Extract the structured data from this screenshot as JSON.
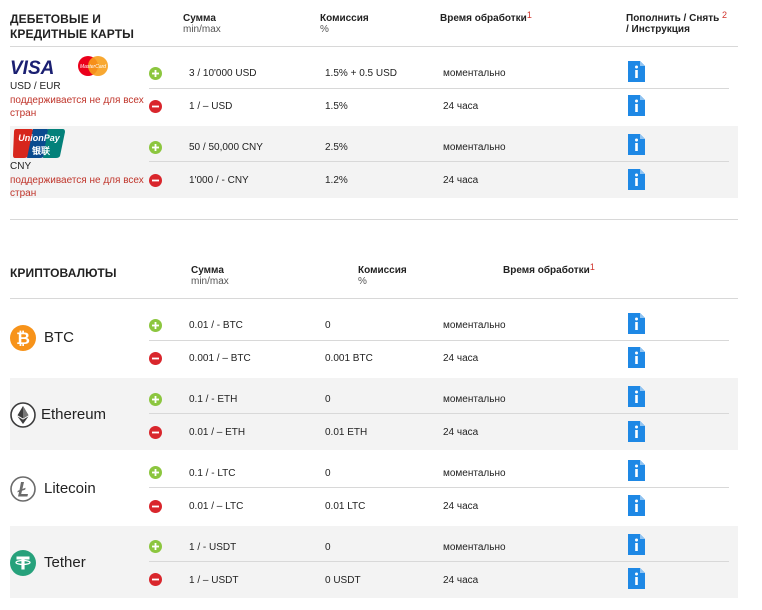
{
  "cards": {
    "title_line1": "ДЕБЕТОВЫЕ И",
    "title_line2": "КРЕДИТНЫЕ КАРТЫ",
    "headers": {
      "sum": "Сумма",
      "sum_sub": "min/max",
      "fee": "Комиссия",
      "fee_sub": "%",
      "time": "Время обработки",
      "time_sup": "1",
      "action": "Пополнить / Снять",
      "action_sup": "2",
      "action_line2": "/ Инструкция"
    },
    "groups": [
      {
        "logo": "visa-mastercard-logo",
        "visa_text": "VISA",
        "mc_text": "MasterCard",
        "currency": "USD / EUR",
        "note": "поддерживается не для всех стран",
        "rows": [
          {
            "type": "deposit",
            "sum": "3 / 10'000 USD",
            "fee": "1.5% + 0.5 USD",
            "time": "моментально"
          },
          {
            "type": "withdraw",
            "sum": "1 / – USD",
            "fee": "1.5%",
            "time": "24 часа"
          }
        ]
      },
      {
        "logo": "unionpay-logo",
        "up_text": "UnionPay",
        "up_cn": "银联",
        "currency": "CNY",
        "note": "поддерживается не для всех стран",
        "rows": [
          {
            "type": "deposit",
            "sum": "50 / 50,000 CNY",
            "fee": "2.5%",
            "time": "моментально"
          },
          {
            "type": "withdraw",
            "sum": "1'000 / - CNY",
            "fee": "1.2%",
            "time": "24 часа"
          }
        ]
      }
    ]
  },
  "crypto": {
    "title": "КРИПТОВАЛЮТЫ",
    "headers": {
      "sum": "Сумма",
      "sum_sub": "min/max",
      "fee": "Комиссия",
      "fee_sub": "%",
      "time": "Время обработки",
      "time_sup": "1"
    },
    "groups": [
      {
        "name": "BTC",
        "icon": "bitcoin-icon",
        "icon_color": "#f7931a",
        "rows": [
          {
            "type": "deposit",
            "sum": "0.01 / - BTC",
            "fee": "0",
            "time": "моментально"
          },
          {
            "type": "withdraw",
            "sum": "0.001 / – BTC",
            "fee": "0.001 BTC",
            "time": "24 часа"
          }
        ]
      },
      {
        "name": "Ethereum",
        "icon": "ethereum-icon",
        "icon_color": "#3c3c3d",
        "rows": [
          {
            "type": "deposit",
            "sum": "0.1 / - ETH",
            "fee": "0",
            "time": "моментально"
          },
          {
            "type": "withdraw",
            "sum": "0.01 / – ETH",
            "fee": "0.01 ETH",
            "time": "24 часа"
          }
        ]
      },
      {
        "name": "Litecoin",
        "icon": "litecoin-icon",
        "icon_color": "#6b6b6b",
        "rows": [
          {
            "type": "deposit",
            "sum": "0.1 / - LTC",
            "fee": "0",
            "time": "моментально"
          },
          {
            "type": "withdraw",
            "sum": "0.01 / – LTC",
            "fee": "0.01 LTC",
            "time": "24 часа"
          }
        ]
      },
      {
        "name": "Tether",
        "icon": "tether-icon",
        "icon_color": "#26a17b",
        "rows": [
          {
            "type": "deposit",
            "sum": "1 / - USDT",
            "fee": "0",
            "time": "моментально"
          },
          {
            "type": "withdraw",
            "sum": "1 / – USDT",
            "fee": "0 USDT",
            "time": "24 часа"
          }
        ]
      }
    ]
  },
  "colors": {
    "deposit": "#8cc63f",
    "withdraw": "#d9262c",
    "info": "#1e88e5",
    "note": "#c0352b",
    "band": "#f3f3f3"
  }
}
